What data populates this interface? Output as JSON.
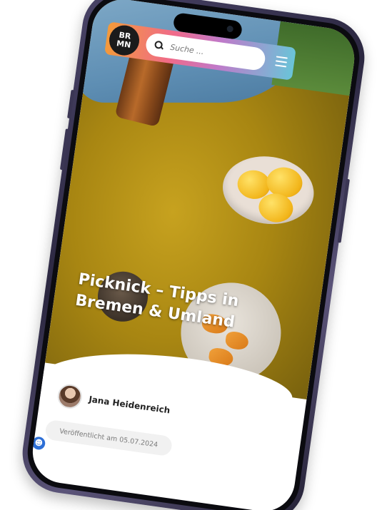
{
  "header": {
    "logo_line1": "BR",
    "logo_line2": "MN",
    "search_placeholder": "Suche ..."
  },
  "article": {
    "title": "Picknick – Tipps in Bremen & Umland",
    "author": "Jana Heidenreich",
    "published": "Veröffentlicht am 05.07.2024"
  },
  "icons": {
    "search": "search-icon",
    "menu": "hamburger-menu-icon",
    "accessibility": "accessibility-icon"
  },
  "colors": {
    "header_gradient": [
      "#f39a3a",
      "#f06a8a",
      "#c079c9",
      "#6ac4d8"
    ],
    "logo_bg": "#1b1b1b",
    "phone_frame": "#3b3654",
    "accessibility_button": "#2d6fd6"
  }
}
